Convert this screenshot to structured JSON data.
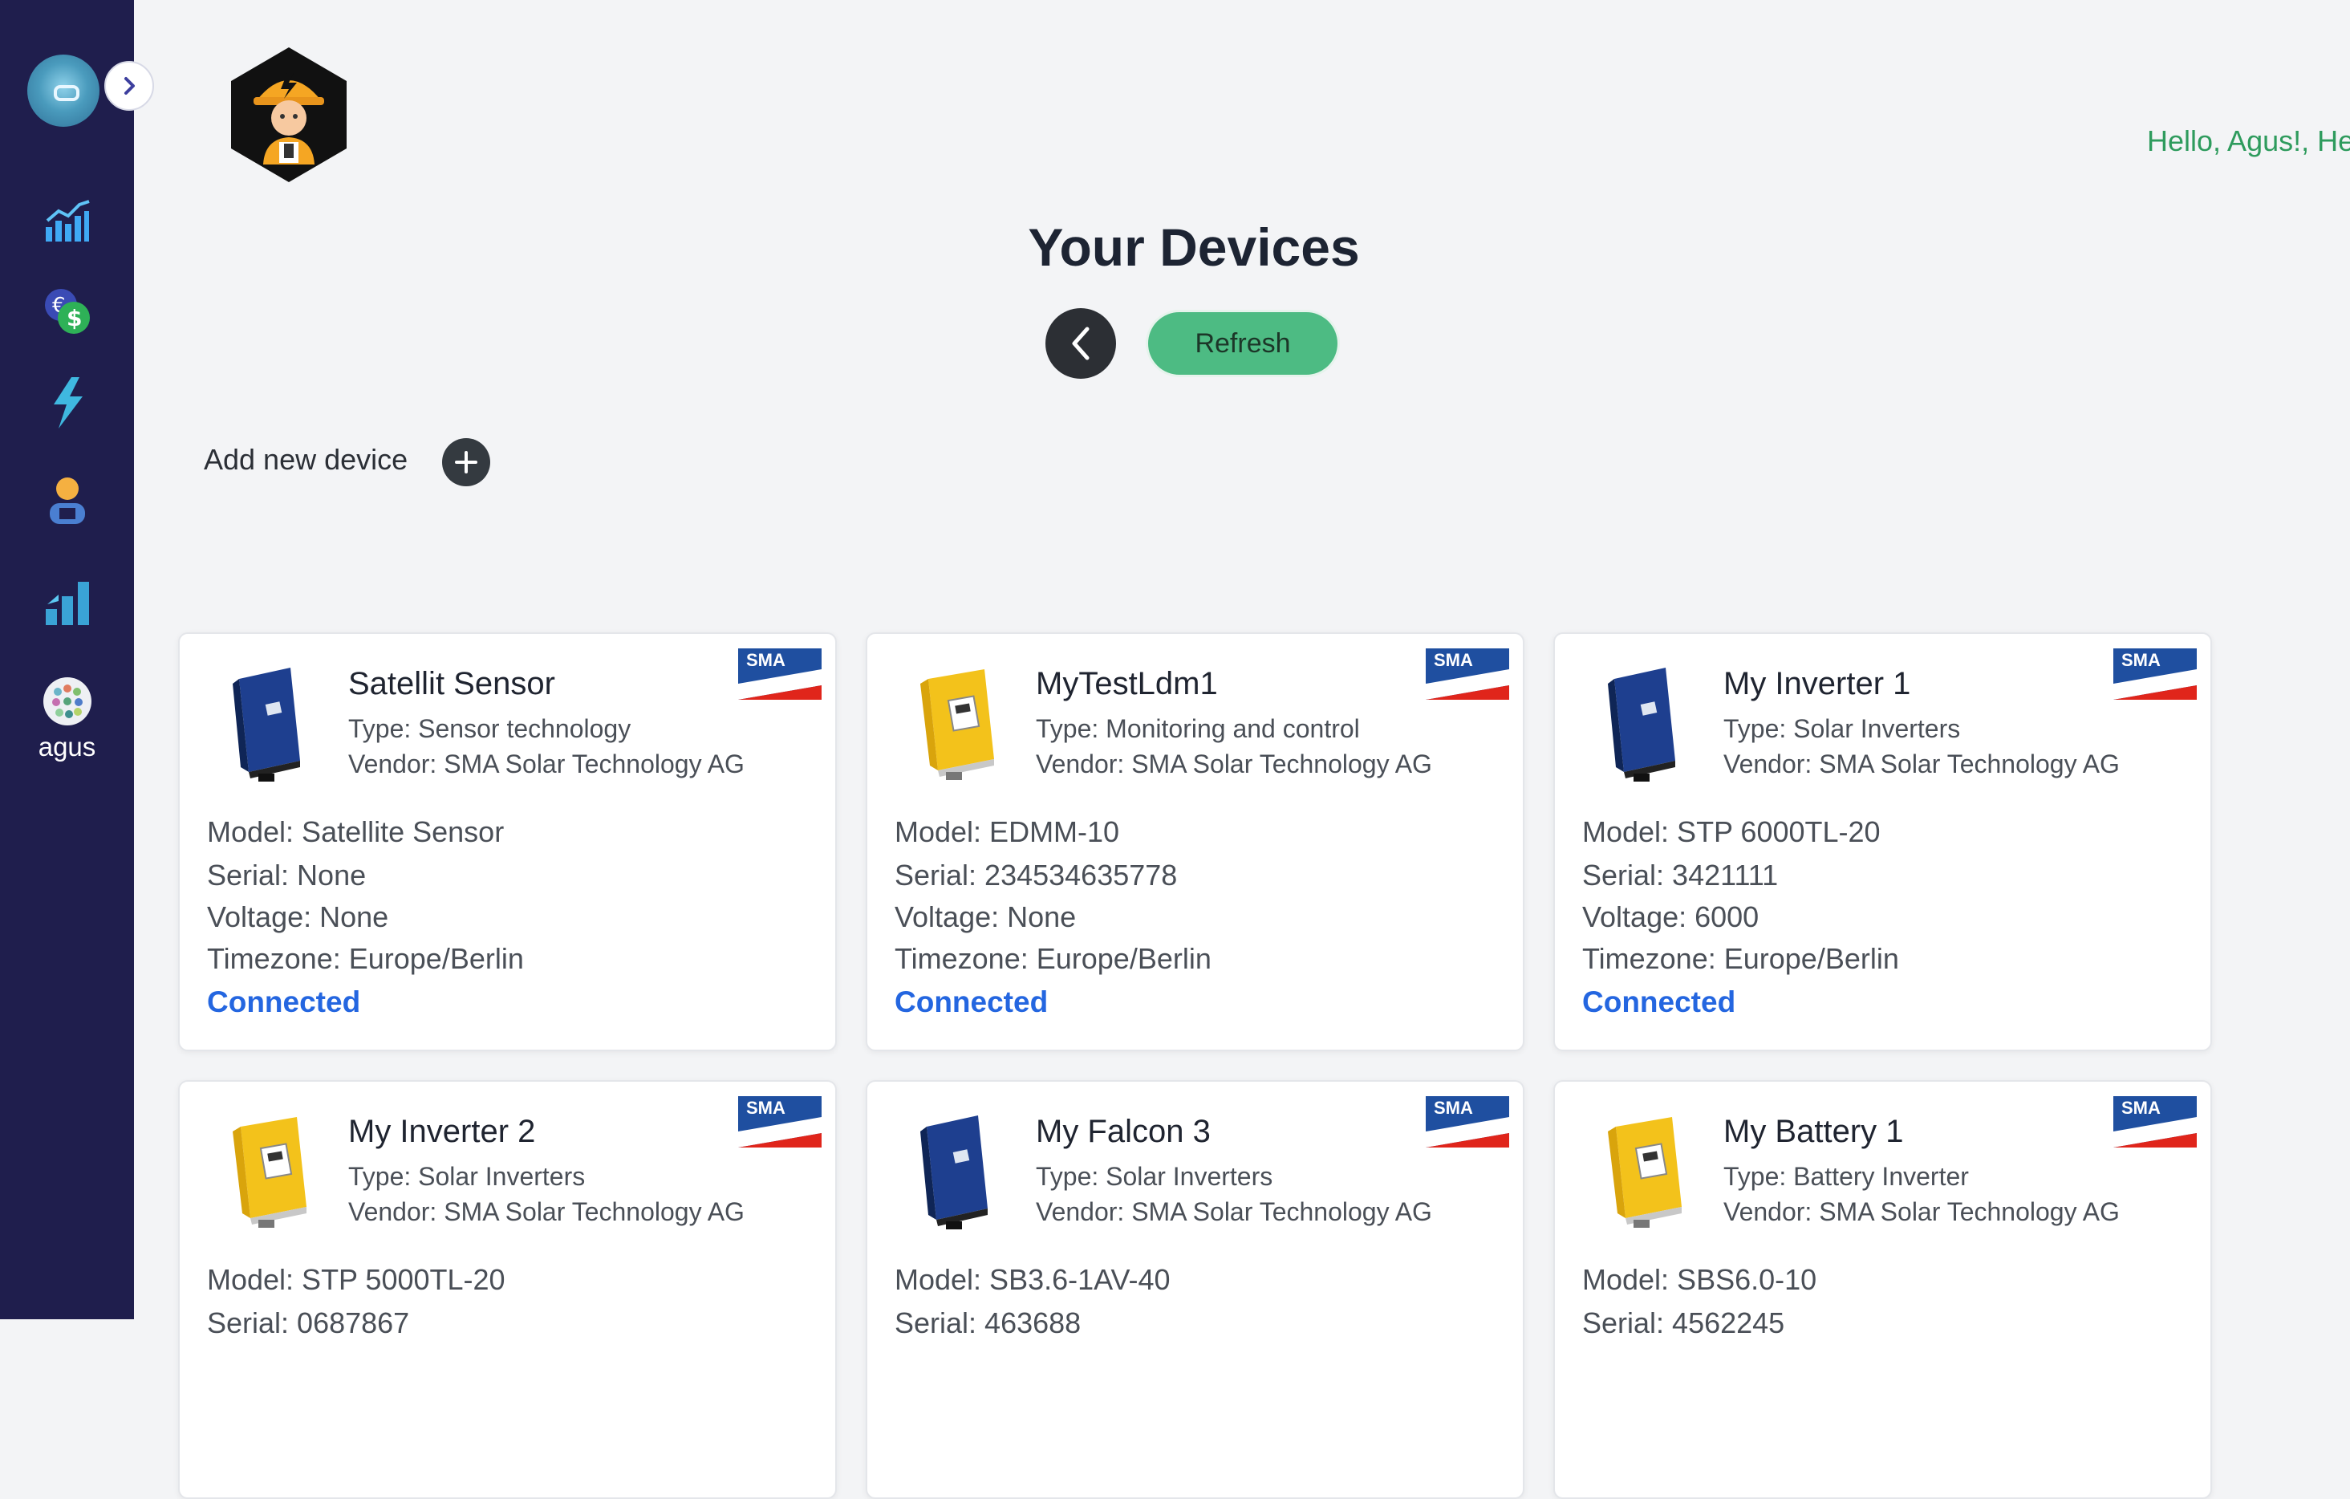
{
  "sidebar": {
    "user_label": "agus",
    "icons": [
      "chart-bars-icon",
      "currency-icon",
      "lightning-icon",
      "engineer-icon",
      "stats-icon",
      "user-avatar-icon"
    ]
  },
  "header": {
    "greeting": "Hello, Agus!, He"
  },
  "main": {
    "title": "Your Devices",
    "refresh_label": "Refresh",
    "add_device_label": "Add new device"
  },
  "colors": {
    "sidebar_bg": "#1f1e4d",
    "accent_green": "#4dbb83",
    "status_blue": "#2466e0",
    "greeting_green": "#2e9b5d"
  },
  "devices": [
    {
      "name": "Satellit Sensor",
      "type": "Type: Sensor technology",
      "vendor": "Vendor: SMA Solar Technology AG",
      "model": "Model: Satellite Sensor",
      "serial": "Serial: None",
      "voltage": "Voltage: None",
      "timezone": "Timezone: Europe/Berlin",
      "status": "Connected",
      "brand": "SMA",
      "image": "blue-inverter"
    },
    {
      "name": "MyTestLdm1",
      "type": "Type: Monitoring and control",
      "vendor": "Vendor: SMA Solar Technology AG",
      "model": "Model: EDMM-10",
      "serial": "Serial: 234534635778",
      "voltage": "Voltage: None",
      "timezone": "Timezone: Europe/Berlin",
      "status": "Connected",
      "brand": "SMA",
      "image": "yellow-inverter"
    },
    {
      "name": "My Inverter 1",
      "type": "Type: Solar Inverters",
      "vendor": "Vendor: SMA Solar Technology AG",
      "model": "Model: STP 6000TL-20",
      "serial": "Serial: 3421111",
      "voltage": "Voltage: 6000",
      "timezone": "Timezone: Europe/Berlin",
      "status": "Connected",
      "brand": "SMA",
      "image": "blue-inverter"
    },
    {
      "name": "My Inverter 2",
      "type": "Type: Solar Inverters",
      "vendor": "Vendor: SMA Solar Technology AG",
      "model": "Model: STP 5000TL-20",
      "serial": "Serial: 0687867",
      "brand": "SMA",
      "image": "yellow-inverter"
    },
    {
      "name": "My Falcon 3",
      "type": "Type: Solar Inverters",
      "vendor": "Vendor: SMA Solar Technology AG",
      "model": "Model: SB3.6-1AV-40",
      "serial": "Serial: 463688",
      "brand": "SMA",
      "image": "blue-inverter"
    },
    {
      "name": "My Battery 1",
      "type": "Type: Battery Inverter",
      "vendor": "Vendor: SMA Solar Technology AG",
      "model": "Model: SBS6.0-10",
      "serial": "Serial: 4562245",
      "brand": "SMA",
      "image": "yellow-inverter"
    }
  ]
}
